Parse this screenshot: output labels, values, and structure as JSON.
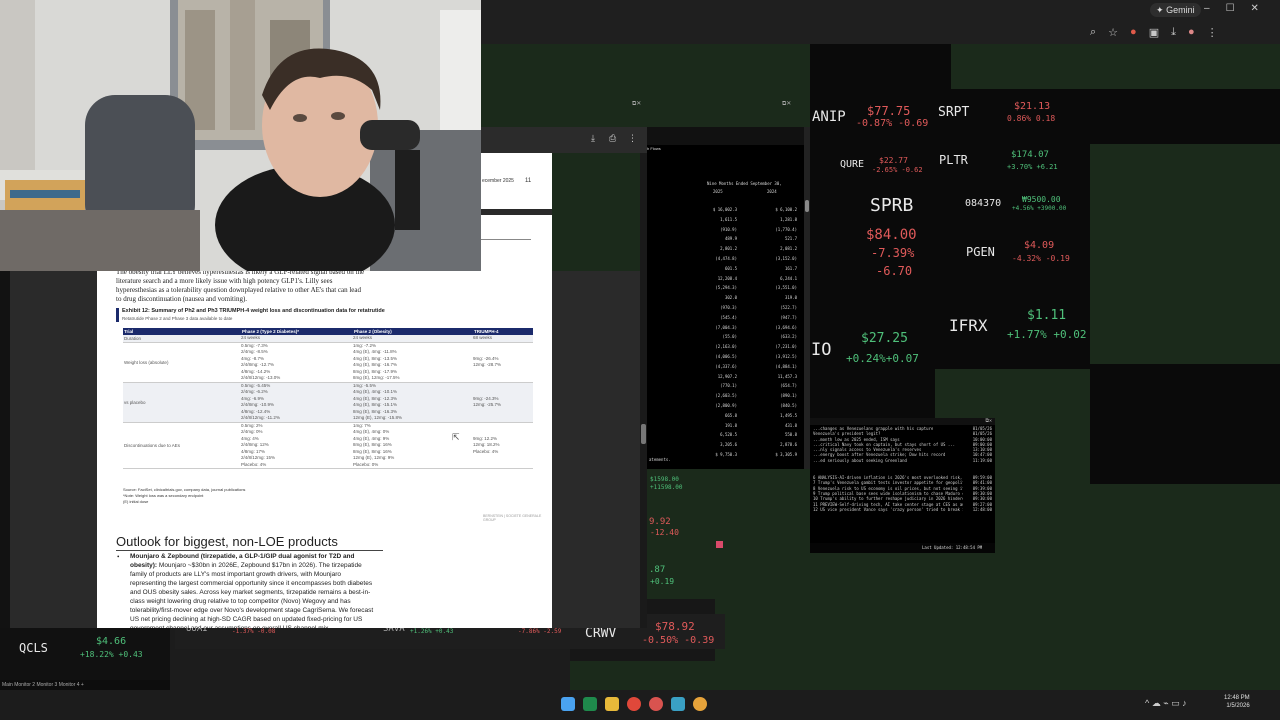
{
  "browser": {
    "gemini_label": "Gemini",
    "window_controls": [
      "–",
      "☐",
      "✕"
    ]
  },
  "document": {
    "page_top_text": "ecember 2025",
    "page_number": "11",
    "intro_lines": [
      "The obesity trial LLY believes hyperesthesias is likely a GLP-related signal based on the",
      "literature search and a more likely issue with high potency GLP1's. Lilly sees",
      "hyperesthesias as a tolerability question downplayed relative to other AE's that can lead",
      "to drug discontinuation (nausea and vomiting)."
    ],
    "exhibit": {
      "title": "Exhibit 12: Summary of Ph2 and Ph3 TRIUMPH-4 weight loss and discontinuation data for retatrutide",
      "subtitle": "Retatrutide Phase 2 and Phase 3 data available to date",
      "headers": [
        "Trial",
        "Phase 2 (Type 2 Diabetes)*",
        "Phase 2 (Obesity)",
        "TRIUMPH-4"
      ],
      "rows": [
        {
          "label": "Duration",
          "c1": [
            "24 weeks"
          ],
          "c2": [
            "24 weeks"
          ],
          "c3": [
            "68 weeks"
          ]
        },
        {
          "label": "Weight loss (absolute)",
          "c1": [
            "0.5mg: -7.3%",
            "2/4mg: -8.5%",
            "4mg: -8.7%",
            "2/4/8mg: -12.7%",
            "4/8mg: -14.2%",
            "2/4/8/12mg: -13.0%"
          ],
          "c2": [
            "1mg: -7.2%",
            "4mg (E), 4mg: -11.8%",
            "4mg (E), 8mg: -13.5%",
            "4mg (E), 8mg: -16.7%",
            "8mg (E), 8mg: -17.9%",
            "8mg (E), 12mg: -17.5%"
          ],
          "c3": [
            "",
            "",
            "9mg: -26.4%",
            "12mg: -28.7%",
            "",
            ""
          ]
        },
        {
          "label": "vs placebo",
          "c1": [
            "0.5mg: -5.45%",
            "2/4mg: -6.2%",
            "4mg: -6.9%",
            "2/4/8mg: -10.9%",
            "4/8mg: -12.4%",
            "2/4/8/12mg: -11.2%"
          ],
          "c2": [
            "1mg: -5.5%",
            "4mg (E), 4mg: -10.1%",
            "4mg (E), 8mg: -12.3%",
            "4mg (E), 8mg: -15.1%",
            "8mg (E), 8mg: -16.3%",
            "12mg (E), 12mg: -15.8%"
          ],
          "c3": [
            "",
            "",
            "9mg: -24.3%",
            "12mg: -25.7%",
            "",
            ""
          ]
        },
        {
          "label": "Discontinuations due to AEs",
          "c1": [
            "0.5mg: 2%",
            "2/4mg: 0%",
            "4mg: 4%",
            "2/4/8mg: 12%",
            "4/8mg: 17%",
            "2/4/8/12mg: 15%",
            "Placebo: 4%"
          ],
          "c2": [
            "1mg: 7%",
            "4mg (E), 4mg: 0%",
            "4mg (E), 4mg: 9%",
            "8mg (E), 8mg: 16%",
            "8mg (E), 8mg: 16%",
            "12mg (E), 12mg: 9%",
            "Placebo: 0%"
          ],
          "c3": [
            "",
            "",
            "9mg: 12.2%",
            "12mg: 18.2%",
            "Placebo: 4%",
            "",
            ""
          ]
        }
      ],
      "source": "Source: FactSet, clinicaltrials.gov, company data, journal publications",
      "footnote1": "*Note: Weight loss was a secondary endpoint",
      "footnote2": "(E) initial dose",
      "watermark": "BERNSTEIN | SOCIETE GENERALE GROUP"
    },
    "section_title": "Outlook for biggest, non-LOE products",
    "bullet_bold": "Mounjaro & Zepbound (tirzepatide, a GLP-1/GIP dual agonist for T2D and obesity):",
    "bullet_lines": [
      "Mounjaro ~$30bn in 2026E, Zepbound $17bn in 2026). The tirzepatide",
      "family of products are LLY's most important growth drivers, with Mounjaro",
      "representing the largest commercial opportunity since it encompasses both",
      "diabetes and OUS obesity sales. Across key market segments, tirzepatide remains a",
      "best-in-class weight lowering drug relative to top competitor (Novo) Wegovy and",
      "has tolerability/first-mover edge over Novo's development stage CagriSema. We",
      "forecast US net pricing declining at high-SD CAGR based on updated fixed-pricing",
      "for US government channel and our assumptions on overall US channel mix."
    ]
  },
  "sheet": {
    "title": "Nine Months Ended September 30,",
    "years": [
      "2025",
      "2024"
    ],
    "rows": [
      [
        "$ 16,002.3",
        "$ 6,100.2"
      ],
      [
        "1,611.5",
        "1,281.8"
      ],
      [
        "(910.9)",
        "(1,770.4)"
      ],
      [
        "489.9",
        "521.7"
      ],
      [
        "2,801.2",
        "2,081.2"
      ],
      [
        "(4,474.8)",
        "(3,152.0)"
      ],
      [
        "601.5",
        "161.7"
      ],
      [
        "12,208.4",
        "6,244.1"
      ],
      [
        "(5,294.3)",
        "(3,551.0)"
      ],
      [
        "302.0",
        "319.0"
      ],
      [
        "(970.3)",
        "(522.7)"
      ],
      [
        "(545.4)",
        "(947.7)"
      ],
      [
        "(7,004.3)",
        "(3,694.6)"
      ],
      [
        "(55.0)",
        "(633.2)"
      ],
      [
        "(2,163.0)",
        "(7,231.0)"
      ],
      [
        "(4,006.5)",
        "(3,912.5)"
      ],
      [
        "(4,337.6)",
        "(4,884.1)"
      ],
      [
        "12,907.2",
        "11,457.3"
      ],
      [
        "(770.1)",
        "(654.7)"
      ],
      [
        "(2,603.5)",
        "(890.1)"
      ],
      [
        "(2,800.9)",
        "(840.5)"
      ],
      [
        "665.8",
        "1,495.5"
      ],
      [
        "191.8",
        "431.8"
      ],
      [
        "6,520.5",
        "550.8"
      ],
      [
        "3,205.6",
        "2,878.6"
      ],
      [
        "$ 9,750.3",
        "$ 3,305.9"
      ]
    ],
    "footer": "atements."
  },
  "news": {
    "headlines": [
      [
        "...changes as Venezuelans grapple with his capture",
        "01/05/26"
      ],
      [
        "Venezuela's president legit?",
        "01/05/26"
      ],
      [
        "...month low as 2025 ended, ISM says",
        "10:00:00"
      ],
      [
        "...critical Navy took on captain, but stays short of US ...",
        "09:00:00"
      ],
      [
        "...nly signals access to Venezuela's reserves",
        "13:10:00"
      ],
      [
        "...energy boost after Venezuela strike; Dow hits record",
        "10:47:00"
      ],
      [
        "...ed seriously about seeking Greenland",
        "11:19:00"
      ],
      [
        "ANALYSIS-AI-driven inflation is 2026's most overlooked risk, investors say",
        "09:59:00"
      ],
      [
        "Trump's Venezuela gambit tests investor appetite for geopolitical risk",
        "09:41:00"
      ],
      [
        "Venezuela risk to US economy is oil prices, but not seeing it yet, Fed's Kashkari ...",
        "09:39:00"
      ],
      [
        "Trump political base sees wide isolationism to chase Maduro capture",
        "09:30:00"
      ],
      [
        "Trump's ability to further reshape judiciary in 2026 hindered by few vacancies",
        "09:30:00"
      ],
      [
        "PREVIEW-Self-driving tech, AI take center stage at CES as automakers dial back EV plans",
        "09:27:00"
      ],
      [
        "US vice president Vance says 'crazy person' tried to break into his home",
        "12:48:00"
      ]
    ],
    "last_updated": "Last Updated: 12:48:54 PM"
  },
  "tickers": {
    "ANIP": {
      "symbol": "ANIP",
      "price": "$77.75",
      "change": "-0.87% -0.69"
    },
    "SRPT": {
      "symbol": "SRPT",
      "price": "$21.13",
      "change": "0.86% 0.18"
    },
    "QURE": {
      "symbol": "QURE",
      "price": "$22.77",
      "change": "-2.65% -0.62"
    },
    "PLTR": {
      "symbol": "PLTR",
      "price": "$174.07",
      "change": "+3.70% +6.21"
    },
    "SPRB": {
      "symbol": "SPRB",
      "price": "$84.00",
      "pct": "-7.39%",
      "abs": "-6.70"
    },
    "084370": {
      "symbol": "084370",
      "price": "₩9500.00",
      "change": "+4.56% +3900.00"
    },
    "PGEN": {
      "symbol": "PGEN",
      "price": "$4.09",
      "change": "-4.32% -0.19"
    },
    "IO": {
      "symbol": "IO",
      "price": "$27.25",
      "change": "+0.24%+0.07"
    },
    "IFRX": {
      "symbol": "IFRX",
      "price": "$1.11",
      "change": "+1.77% +0.02"
    },
    "CRWV": {
      "symbol": "CRWV",
      "price": "$78.92",
      "change": "-0.50% -0.39"
    },
    "QCLS": {
      "symbol": "QCLS",
      "price": "$4.66",
      "change": "+18.22% +0.43"
    },
    "partial_left_1": {
      "price": "$1598.00",
      "change": "+11598.00"
    },
    "partial_left_2": {
      "price": "9.92",
      "change": "-12.40"
    },
    "partial_left_3": {
      "price": ".87",
      "change": "+0.19"
    },
    "bottom_snippets": [
      "-1.37% -0.08",
      "+1.26% +0.43",
      "-7.86% -2.59"
    ],
    "bottom_labels": [
      "UUAI",
      "SAVA"
    ]
  },
  "taskbar": {
    "monitor_tabs": "Main  Monitor 2  Monitor 3  Monitor 4  +",
    "time": "12:48 PM",
    "date": "1/5/2026"
  }
}
